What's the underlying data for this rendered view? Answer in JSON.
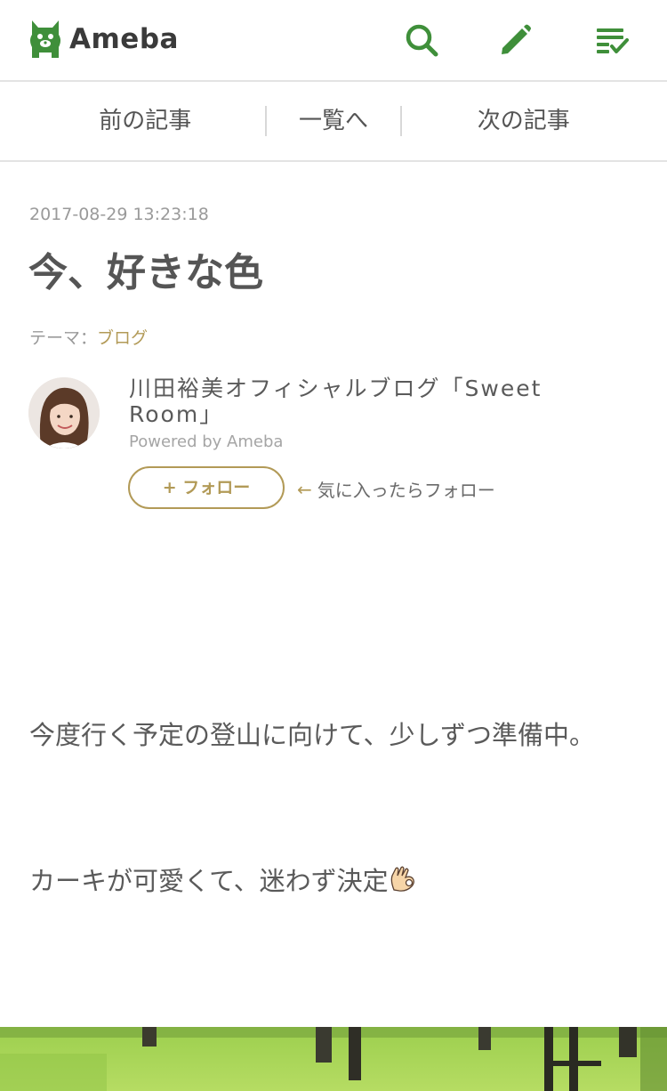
{
  "header": {
    "logo_text": "Ameba",
    "icons": [
      "search-icon",
      "pencil-icon",
      "menu-list-icon"
    ],
    "brand_color": "#3f8f3a"
  },
  "nav": {
    "prev_label": "前の記事",
    "list_label": "一覧へ",
    "next_label": "次の記事"
  },
  "article": {
    "date": "2017-08-29 13:23:18",
    "title": "今、好きな色",
    "theme_label": "テーマ：",
    "theme_value": "ブログ",
    "paragraphs": [
      "今度行く予定の登山に向けて、少しずつ準備中。",
      "カーキが可愛くて、迷わず決定"
    ],
    "emoji": "ok-hand-icon"
  },
  "author": {
    "blog_name": "川田裕美オフィシャルブログ「Sweet Room」",
    "powered": "Powered by Ameba",
    "follow_label": "+ フォロー",
    "follow_hint": "気に入ったらフォロー",
    "accent_color": "#b29a57"
  }
}
